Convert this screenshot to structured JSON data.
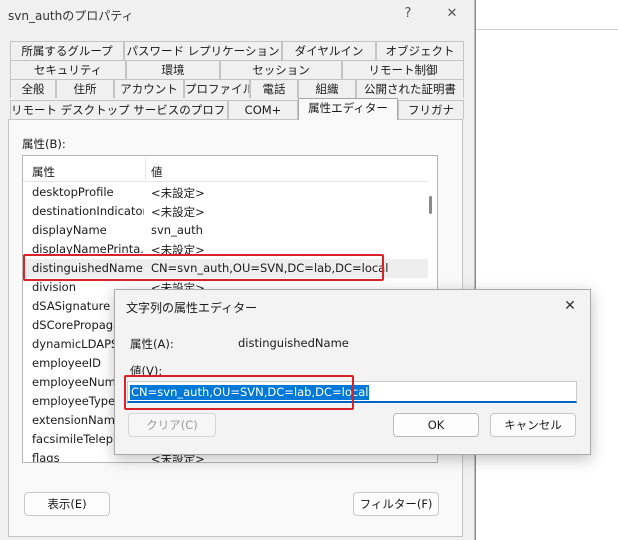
{
  "window": {
    "title": "svn_authのプロパティ",
    "help_icon": "help-icon",
    "close_icon": "close-icon"
  },
  "tabs": {
    "row1": [
      "所属するグループ",
      "パスワード レプリケーション",
      "ダイヤルイン",
      "オブジェクト"
    ],
    "row2": [
      "セキュリティ",
      "環境",
      "セッション",
      "リモート制御"
    ],
    "row3": [
      "全般",
      "住所",
      "アカウント",
      "プロファイル",
      "電話",
      "組織",
      "公開された証明書"
    ],
    "row4": [
      "リモート デスクトップ サービスのプロファイル",
      "COM+",
      "属性エディター",
      "フリガナ"
    ],
    "active": "属性エディター"
  },
  "attributes": {
    "label": "属性(B):",
    "columns": {
      "attr": "属性",
      "value": "値"
    },
    "rows": [
      {
        "name": "desktopProfile",
        "value": "<未設定>"
      },
      {
        "name": "destinationIndicator",
        "value": "<未設定>"
      },
      {
        "name": "displayName",
        "value": "svn_auth"
      },
      {
        "name": "displayNamePrinta...",
        "value": "<未設定>"
      },
      {
        "name": "distinguishedName",
        "value": "CN=svn_auth,OU=SVN,DC=lab,DC=local"
      },
      {
        "name": "division",
        "value": "<未設定>"
      },
      {
        "name": "dSASignature",
        "value": ""
      },
      {
        "name": "dSCorePropagat",
        "value": ""
      },
      {
        "name": "dynamicLDAPSe",
        "value": ""
      },
      {
        "name": "employeeID",
        "value": ""
      },
      {
        "name": "employeeNumb",
        "value": ""
      },
      {
        "name": "employeeType",
        "value": ""
      },
      {
        "name": "extensionName",
        "value": ""
      },
      {
        "name": "facsimileTeleph",
        "value": ""
      },
      {
        "name": "flags",
        "value": "<未設定>"
      }
    ],
    "selected_index": 4
  },
  "buttons": {
    "view": "表示(E)",
    "filter": "フィルター(F)"
  },
  "string_editor": {
    "title": "文字列の属性エディター",
    "attr_label": "属性(A):",
    "attr_value": "distinguishedName",
    "value_label": "値(V):",
    "value": "CN=svn_auth,OU=SVN,DC=lab,DC=local",
    "clear": "クリア(C)",
    "ok": "OK",
    "cancel": "キャンセル"
  },
  "colors": {
    "highlight": "#d8232a",
    "selection": "#0078d7",
    "focus_underline": "#0067c0"
  }
}
